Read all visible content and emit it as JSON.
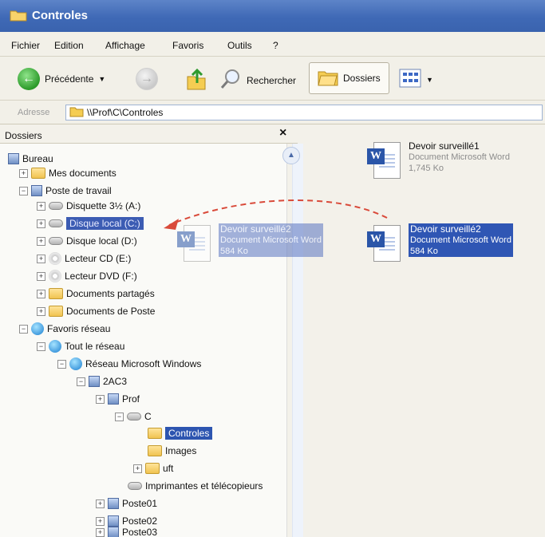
{
  "window": {
    "title": "Controles"
  },
  "menu": [
    "Fichier",
    "Edition",
    "Affichage",
    "Favoris",
    "Outils",
    "?"
  ],
  "toolbar": {
    "back_label": "Précédente",
    "search_label": "Rechercher",
    "folders_label": "Dossiers"
  },
  "address": {
    "label": "Adresse",
    "value": "\\\\Prof\\C\\Controles"
  },
  "folders_pane": {
    "title": "Dossiers",
    "close_glyph": "×",
    "items": [
      {
        "label": "Bureau"
      },
      {
        "label": "Mes documents"
      },
      {
        "label": "Poste de travail"
      },
      {
        "label": "Disquette 3½ (A:)"
      },
      {
        "label": "Disque local (C:)"
      },
      {
        "label": "Disque local (D:)"
      },
      {
        "label": "Lecteur CD (E:)"
      },
      {
        "label": "Lecteur DVD (F:)"
      },
      {
        "label": "Documents partagés"
      },
      {
        "label": "Documents de Poste"
      },
      {
        "label": "Favoris réseau"
      },
      {
        "label": "Tout le réseau"
      },
      {
        "label": "Réseau Microsoft Windows"
      },
      {
        "label": "2AC3"
      },
      {
        "label": "Prof"
      },
      {
        "label": "C"
      },
      {
        "label": "Controles"
      },
      {
        "label": "Images"
      },
      {
        "label": "uft"
      },
      {
        "label": "Imprimantes et télécopieurs"
      },
      {
        "label": "Poste01"
      },
      {
        "label": "Poste02"
      },
      {
        "label": "Poste03"
      }
    ]
  },
  "files": [
    {
      "name": "Devoir surveillé1",
      "type": "Document Microsoft Word",
      "size": "1,745 Ko",
      "state": "normal"
    },
    {
      "name": "Devoir surveillé2",
      "type": "Document Microsoft Word",
      "size": "584 Ko",
      "state": "drag-ghost"
    },
    {
      "name": "Devoir surveillé2",
      "type": "Document Microsoft Word",
      "size": "584 Ko",
      "state": "selected"
    }
  ],
  "colors": {
    "titlebar": "#3f69b6",
    "selection": "#2f56b4",
    "drag_arrow": "#d94a3a"
  }
}
